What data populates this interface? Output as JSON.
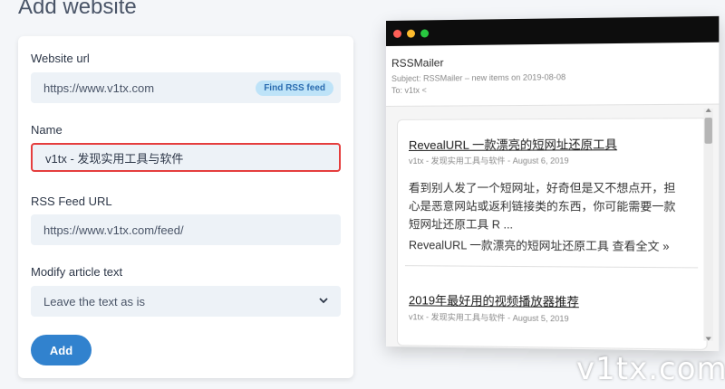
{
  "page": {
    "title": "Add website"
  },
  "form": {
    "url_label": "Website url",
    "url_value": "https://www.v1tx.com",
    "find_rss_label": "Find RSS feed",
    "name_label": "Name",
    "name_value": "v1tx - 发现实用工具与软件",
    "rss_label": "RSS Feed URL",
    "rss_value": "https://www.v1tx.com/feed/",
    "modify_label": "Modify article text",
    "modify_value": "Leave the text as is",
    "add_button": "Add"
  },
  "mail": {
    "from": "RSSMailer",
    "subject": "Subject: RSSMailer – new items on 2019-08-08",
    "to": "To: v1tx <",
    "window_dots": {
      "close": "#ff5f57",
      "minimize": "#febc2e",
      "maximize": "#28c840"
    },
    "articles": [
      {
        "title": "RevealURL 一款漂亮的短网址还原工具",
        "meta": "v1tx - 发现实用工具与软件 - August 6, 2019",
        "excerpt": "看到别人发了一个短网址，好奇但是又不想点开，担心是恶意网站或返利链接类的东西，你可能需要一款短网址还原工具 R ...",
        "more": "RevealURL 一款漂亮的短网址还原工具 查看全文 »"
      },
      {
        "title": "2019年最好用的视频播放器推荐",
        "meta": "v1tx - 发现实用工具与软件 - August 5, 2019"
      }
    ]
  },
  "watermark": "v1tx.com",
  "colors": {
    "accent": "#3182ce",
    "focus_border": "#e53e3e",
    "field_bg": "#edf2f7"
  }
}
